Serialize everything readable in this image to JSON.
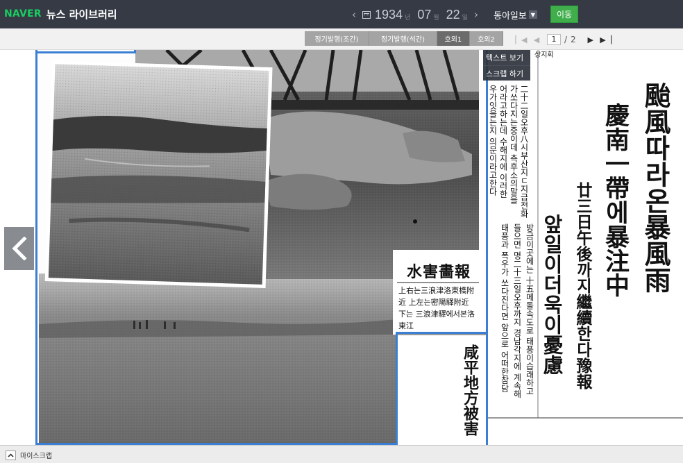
{
  "header": {
    "logo_brand": "NAVER",
    "logo_title": "뉴스 라이브러리",
    "date": {
      "year": "1934",
      "year_unit": "년",
      "month": "07",
      "month_unit": "월",
      "day": "22",
      "day_unit": "일"
    },
    "newspaper": "동아일보",
    "go_label": "이동"
  },
  "toolbar": {
    "tabs": [
      {
        "label": "정기발행(조간)",
        "active": false
      },
      {
        "label": "정기발행(석간)",
        "active": false
      },
      {
        "label": "호외1",
        "active": true
      },
      {
        "label": "호외2",
        "active": false
      }
    ],
    "page_current": "1",
    "page_separator": "/",
    "page_total": "2"
  },
  "context_menu": {
    "view_text": "텍스트 보기",
    "scrap": "스크랩 하기"
  },
  "article": {
    "headline_1": "颱風따라온暴風雨",
    "headline_2": "慶南一帶에暴注中",
    "subhead_1": "廿三日午後까지繼續한다豫報",
    "subhead_2": "앞일이더욱이憂慮",
    "photo_title": "水害畵報",
    "caption_1": "上右는三浪津洛東橋附近 上左는密陽驛附近",
    "caption_2": "下는 三浪津驛에서본洛東江",
    "side_title": "咸平地方被害",
    "body_col_1": "二十二일오후八시부산지ㄷ지급전화",
    "body_col_2": "가쏘다지는중이데 측후소의말을",
    "body_col_3": "어라고하는데 수해지에 이러한",
    "body_col_4": "우가잇을는지 의문이라고한다",
    "body_col_5": "방금이곳에는 十五메돌속도로 태풍이습래하고",
    "body_col_6": "들으면 명二十三일오후까지 경남각지에 계속해",
    "body_col_7": "태풍과 폭우가 쏘다진다면 앞으로 어떠한참담",
    "corner_text": "상지회"
  },
  "bottom": {
    "myscrap_label": "마이스크랩"
  }
}
